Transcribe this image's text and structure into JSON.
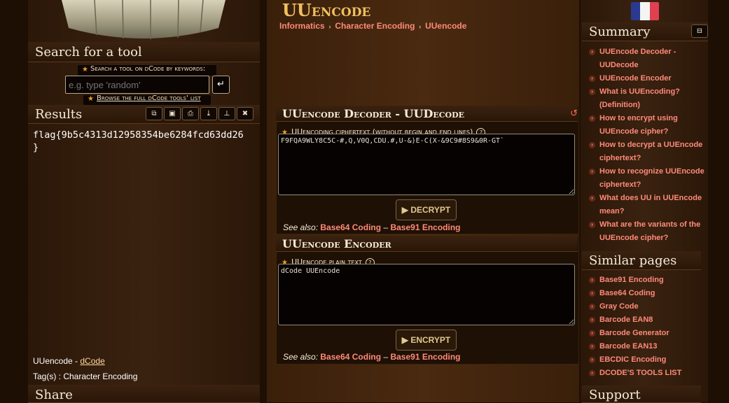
{
  "page": {
    "title": "UUencode",
    "breadcrumb": [
      "Informatics",
      "Character Encoding",
      "UUencode"
    ]
  },
  "left": {
    "search_heading": "Search for a tool",
    "search_label": "Search a tool on dCode by keywords:",
    "search_placeholder": "e.g. type 'random'",
    "browse_label": "Browse the full dCode tools' list",
    "results_heading": "Results",
    "result_text": "flag{9b5c4313d12958354be6284fcd63dd26\n}",
    "footer_name": "UUencode - ",
    "footer_link": "dCode",
    "tags": "Tag(s) : Character Encoding",
    "share_heading": "Share"
  },
  "decoder": {
    "title": "UUencode Decoder - UUDecode",
    "field_label": "UUencoding ciphertext (without begin and end lines)",
    "ciphertext": "F9FQA9WLY8C5C-#,Q,V0Q,CDU.#,U-&)E-C(X-&9C9#8S9&0R-GT`",
    "button": "DECRYPT",
    "see_also": "See also:",
    "links": [
      "Base64 Coding",
      "Base91 Encoding"
    ]
  },
  "encoder": {
    "title": "UUencode Encoder",
    "field_label": "UUencode plain text",
    "plaintext": "dCode UUEncode",
    "button": "ENCRYPT",
    "see_also": "See also:",
    "links": [
      "Base64 Coding",
      "Base91 Encoding"
    ]
  },
  "summary": {
    "heading": "Summary",
    "items": [
      "UUEncode Decoder - UUDecode",
      "UUEncode Encoder",
      "What is UUEncoding? (Definition)",
      "How to encrypt using UUEncode cipher?",
      "How to decrypt a UUEncode ciphertext?",
      "How to recognize UUEncode ciphertext?",
      "What does UU in UUEncode mean?",
      "What are the variants of the UUEncode cipher?"
    ]
  },
  "similar": {
    "heading": "Similar pages",
    "items": [
      "Base91 Encoding",
      "Base64 Coding",
      "Gray Code",
      "Barcode EAN8",
      "Barcode Generator",
      "Barcode EAN13",
      "EBCDIC Encoding",
      "DCODE'S TOOLS LIST"
    ]
  },
  "support_heading": "Support",
  "colors": {
    "accent": "#ff8a7a",
    "star": "#f0a020"
  }
}
